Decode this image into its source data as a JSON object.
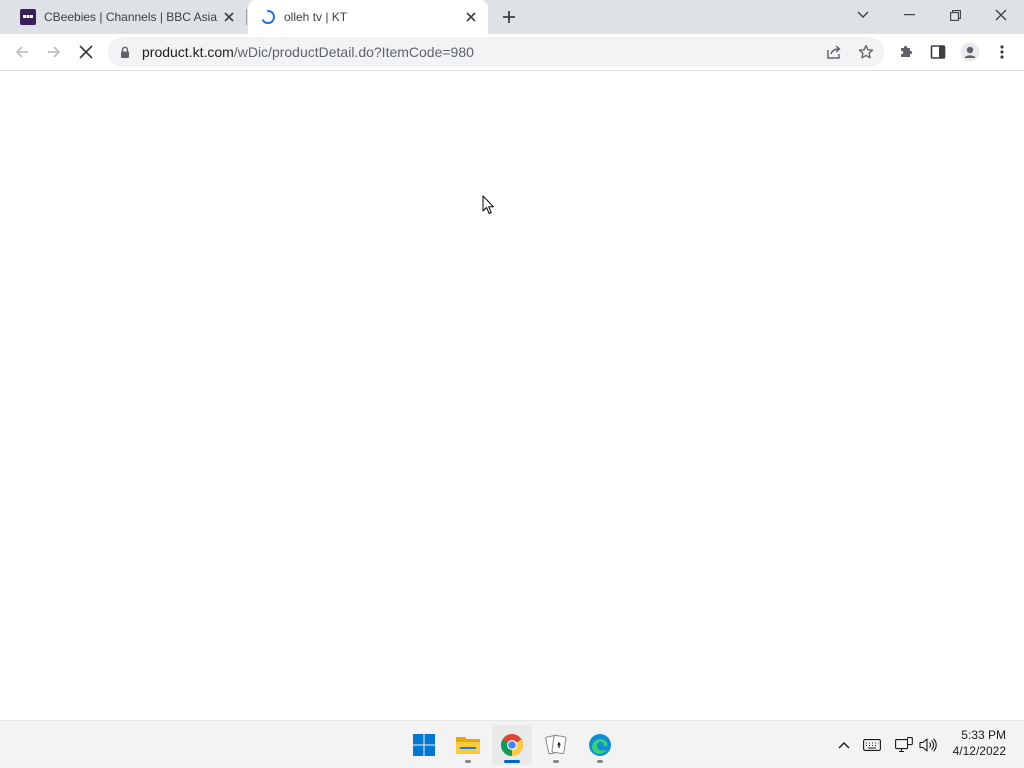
{
  "browser": {
    "tabs": [
      {
        "title": "CBeebies | Channels | BBC Asia",
        "active": false,
        "favicon": "bbc-favicon-icon"
      },
      {
        "title": "olleh tv | KT",
        "active": true,
        "favicon": "loading-spinner-icon"
      }
    ],
    "address_bar": {
      "host": "product.kt.com",
      "path": "/wDic/productDetail.do?ItemCode=980"
    },
    "colors": {
      "tabstrip": "#dee1e6",
      "omnibox": "#f1f3f4",
      "spinner": "#1a73e8"
    }
  },
  "taskbar": {
    "apps": [
      {
        "name": "start-button",
        "icon": "windows-logo-icon"
      },
      {
        "name": "file-explorer",
        "icon": "folder-icon"
      },
      {
        "name": "chrome",
        "icon": "chrome-icon",
        "active": true
      },
      {
        "name": "solitaire",
        "icon": "cards-icon"
      },
      {
        "name": "edge",
        "icon": "edge-icon"
      }
    ],
    "clock": {
      "time": "5:33 PM",
      "date": "4/12/2022"
    },
    "accent": "#0067c0"
  }
}
